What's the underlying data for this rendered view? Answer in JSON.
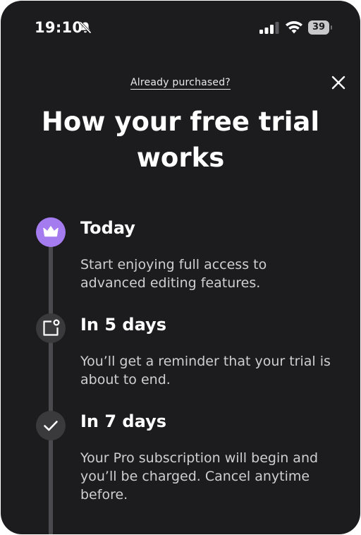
{
  "status_bar": {
    "time": "19:10",
    "battery_level": "39",
    "icons": [
      "bell-slash-icon",
      "cellular-signal-icon",
      "wifi-icon",
      "battery-icon"
    ]
  },
  "header": {
    "already_purchased_link": "Already purchased?",
    "close_icon": "close-icon"
  },
  "title": "How your free trial works",
  "timeline": {
    "steps": [
      {
        "heading": "Today",
        "description": "Start enjoying full access to advanced editing features.",
        "icon": "crown-icon",
        "icon_bg": "#a47cf0"
      },
      {
        "heading": "In 5 days",
        "description": "You’ll get a reminder that your trial is about to end.",
        "icon": "notification-icon",
        "icon_bg": "#3a393c"
      },
      {
        "heading": "In 7 days",
        "description": "Your Pro subscription will begin and you’ll be charged. Cancel anytime before.",
        "icon": "checkmark-icon",
        "icon_bg": "#3a393c"
      }
    ]
  },
  "colors": {
    "background": "#1c1b1d",
    "accent": "#a47cf0",
    "text_primary": "#ffffff",
    "text_secondary": "#cfcfd1"
  }
}
